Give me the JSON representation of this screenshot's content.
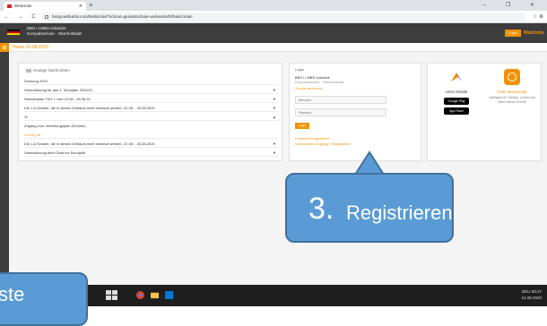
{
  "browser": {
    "tab_title": "WebUntis",
    "url": "herpy.webuntis.com/WebUntis/?school=gesamtschule-ueckendorf#/basic/main",
    "new_tab": "+",
    "window_controls": "– ❐ ✕",
    "nav_icons": "← → C",
    "profile_icons": "☆ ⊕"
  },
  "app": {
    "school_line1": "BBS I LMBS Industrie",
    "school_line2": "Kompaktschule · Oberhofstadt",
    "login_button": "Login",
    "brand": "WebUntis",
    "date": "Heute 24.08.2020",
    "flag_colors": [
      "#000000",
      "#dd0000",
      "#ffce00"
    ],
    "accent": "#f39200"
  },
  "news": {
    "header": "Heutige Nachrichten",
    "rows": [
      {
        "text": "Deckung 2020",
        "orange": false
      },
      {
        "text": "Unterstützung für das 1. Schuljahr 2020/21",
        "orange": false
      },
      {
        "text": "Stundenplan TAG 1 vom 24.08 - 28.08.20",
        "orange": false
      },
      {
        "text": "Die 1-6 Schüler, die in diesen Zeitraum nicht beschult werden, 22.08. - 26.08.2020",
        "orange": false
      },
      {
        "text": "%",
        "orange": false
      },
      {
        "text": "Zugang zum Vertretungsplan (Schüler)",
        "orange": false
      },
      {
        "text": "% info.pdf",
        "orange": true
      },
      {
        "text": "Die 1-6 Schüler, die in diesen Zeitraum nicht beschult werden, 22.08. - 26.08.2020",
        "orange": false
      },
      {
        "text": "Unterstützung beim Start ins Schuljahr",
        "orange": false
      }
    ]
  },
  "login": {
    "title": "Login",
    "school_label": "BBS I LMBS Industrie",
    "school_sub": "Kompaktschule · Oberhofstadt",
    "change_school": "Schule wechseln",
    "user_placeholder": "Benutzer",
    "password_placeholder": "Passwort",
    "button": "Login",
    "forgot": "Passwort vergessen?",
    "no_access": "Noch keinen Zugang?",
    "register": "Registrieren"
  },
  "apps": {
    "mobile_title": "Untis Mobile",
    "google_play": "Google Play",
    "app_store": "App Store",
    "messenger_title": "Untis Messenger",
    "messenger_desc": "Verfügbar für Schüler, Lehrer und Eltern dieser Schule"
  },
  "callouts": {
    "register_number": "3.",
    "register_label": "Registrieren",
    "partial_label": "ste"
  },
  "taskbar": {
    "time": "08:47",
    "date": "24.08.2020",
    "lang": "DEU"
  }
}
